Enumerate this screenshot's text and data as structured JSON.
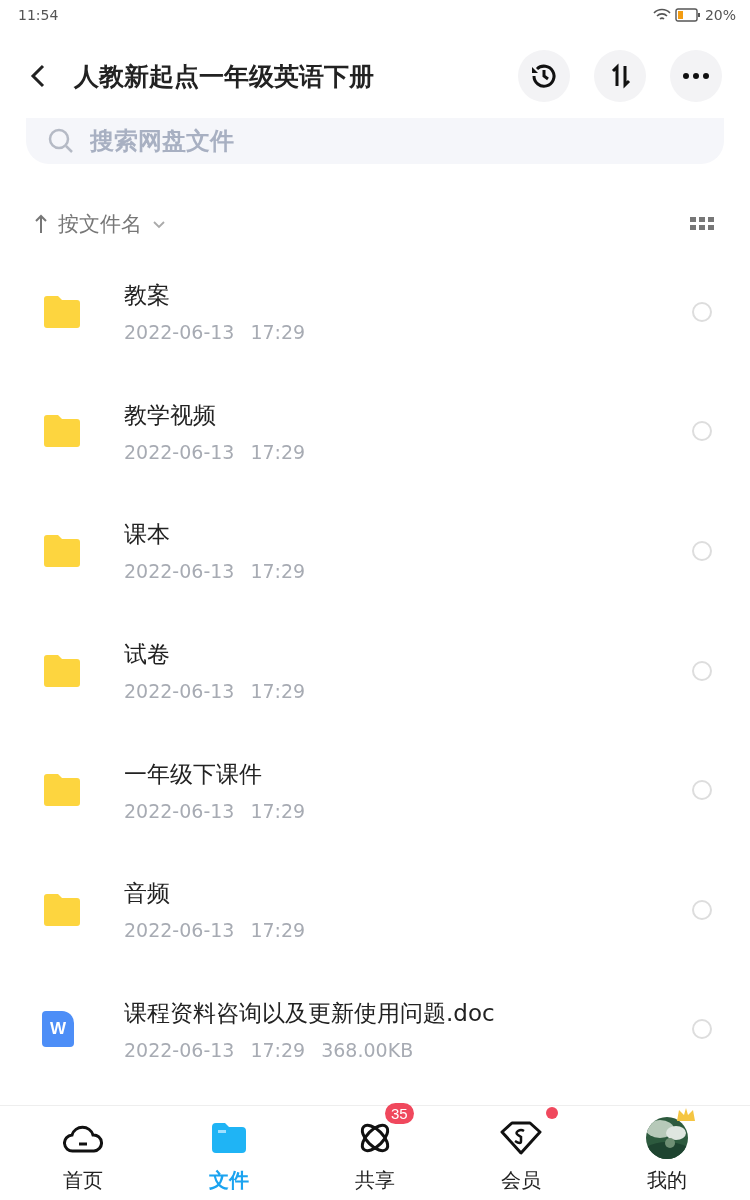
{
  "status_bar": {
    "time": "11:54",
    "battery": "20%"
  },
  "header": {
    "title": "人教新起点一年级英语下册"
  },
  "search": {
    "placeholder": "搜索网盘文件"
  },
  "sort": {
    "label": "按文件名"
  },
  "files": [
    {
      "kind": "folder",
      "name": "教案",
      "date": "2022-06-13",
      "time": "17:29",
      "selected": false
    },
    {
      "kind": "folder",
      "name": "教学视频",
      "date": "2022-06-13",
      "time": "17:29",
      "selected": false
    },
    {
      "kind": "folder",
      "name": "课本",
      "date": "2022-06-13",
      "time": "17:29",
      "selected": false
    },
    {
      "kind": "folder",
      "name": "试卷",
      "date": "2022-06-13",
      "time": "17:29",
      "selected": false
    },
    {
      "kind": "folder",
      "name": "一年级下课件",
      "date": "2022-06-13",
      "time": "17:29",
      "selected": false
    },
    {
      "kind": "folder",
      "name": "音频",
      "date": "2022-06-13",
      "time": "17:29",
      "selected": false
    },
    {
      "kind": "doc",
      "name": "课程资料咨询以及更新使用问题.doc",
      "date": "2022-06-13",
      "time": "17:29",
      "size": "368.00KB",
      "icon_letter": "W",
      "selected": false
    }
  ],
  "nav": [
    {
      "kind": "home",
      "label": "首页",
      "selected": false
    },
    {
      "kind": "files",
      "label": "文件",
      "selected": true
    },
    {
      "kind": "share",
      "label": "共享",
      "badge": "35",
      "selected": false
    },
    {
      "kind": "vip",
      "label": "会员",
      "dot": true,
      "selected": false
    },
    {
      "kind": "me",
      "label": "我的",
      "selected": false
    }
  ]
}
